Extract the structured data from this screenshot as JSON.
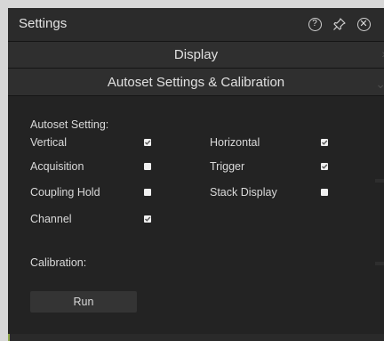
{
  "window": {
    "title": "Settings",
    "help_icon": "help-circle-icon",
    "pin_icon": "pin-icon",
    "close_icon": "close-circle-icon"
  },
  "sections": {
    "display": {
      "label": "Display",
      "expanded": false
    },
    "autoset": {
      "label": "Autoset Settings & Calibration",
      "expanded": true
    }
  },
  "autoset": {
    "heading": "Autoset Setting:",
    "options": {
      "vertical": {
        "label": "Vertical",
        "checked": true
      },
      "horizontal": {
        "label": "Horizontal",
        "checked": true
      },
      "acquisition": {
        "label": "Acquisition",
        "checked": false
      },
      "trigger": {
        "label": "Trigger",
        "checked": true
      },
      "coupling_hold": {
        "label": "Coupling Hold",
        "checked": false
      },
      "stack_display": {
        "label": "Stack Display",
        "checked": false
      },
      "channel": {
        "label": "Channel",
        "checked": true
      }
    }
  },
  "calibration": {
    "heading": "Calibration:",
    "run_label": "Run"
  },
  "colors": {
    "panel_bg": "#232323",
    "header_bg": "#2f2f2f",
    "text": "#dadada",
    "checkbox": "#f0f0f0"
  }
}
